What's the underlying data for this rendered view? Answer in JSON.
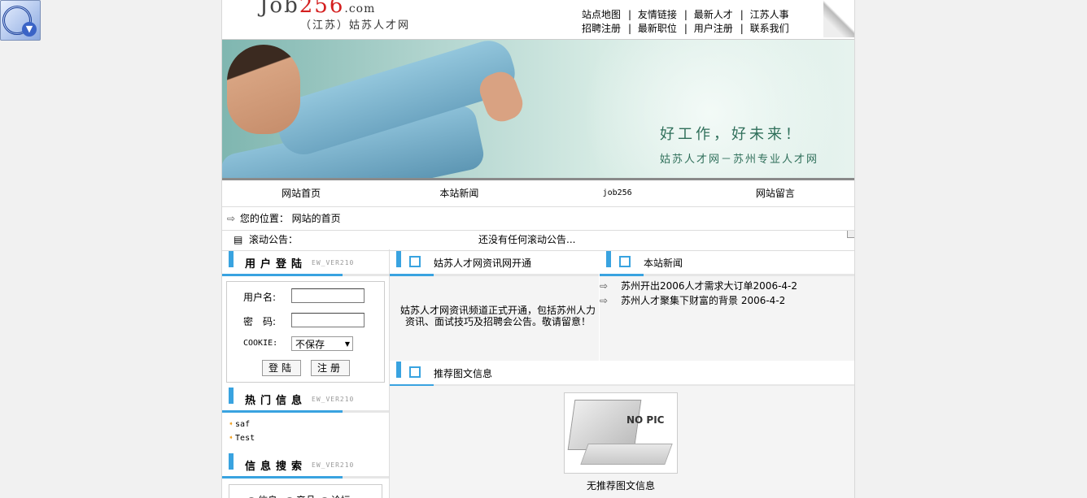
{
  "site": {
    "logo_text": "Job",
    "logo_num": "256",
    "logo_dot": ".com",
    "logo_sub": "（江苏）姑苏人才网"
  },
  "toplinks": {
    "row1": [
      "站点地图",
      "友情链接",
      "最新人才",
      "江苏人事"
    ],
    "row2": [
      "招聘注册",
      "最新职位",
      "用户注册",
      "联系我们"
    ]
  },
  "banner": {
    "slogan1": "好工作，好未来！",
    "slogan2": "姑苏人才网－苏州专业人才网"
  },
  "nav": [
    "网站首页",
    "本站新闻",
    "job256",
    "网站留言"
  ],
  "breadcrumb": {
    "label": "您的位置：",
    "value": "网站的首页"
  },
  "notice": {
    "label": "滚动公告：",
    "text": "还没有任何滚动公告..."
  },
  "login": {
    "title": "用户登陆",
    "ver": "EW_VER210",
    "username_label": "用户名:",
    "password_label": "密　码:",
    "cookie_label": "COOKIE:",
    "cookie_value": "不保存",
    "login_button": "登陆",
    "register_button": "注册"
  },
  "hot": {
    "title": "热门信息",
    "ver": "EW_VER210",
    "items": [
      "saf",
      "Test"
    ]
  },
  "search": {
    "title": "信息搜索",
    "ver": "EW_VER210",
    "options": [
      "信息",
      "产品",
      "论坛"
    ],
    "selected": "信息"
  },
  "channel": {
    "title": "姑苏人才网资讯网开通",
    "text": "姑苏人才网资讯频道正式开通，包括苏州人力资讯、面试技巧及招聘会公告。敬请留意！"
  },
  "news": {
    "title": "本站新闻",
    "items": [
      "苏州开出2006人才需求大订单2006-4-2",
      "苏州人才聚集下财富的背景 2006-4-2"
    ]
  },
  "recommend": {
    "title": "推荐图文信息",
    "nopic_label": "NO PIC",
    "caption": "无推荐图文信息"
  }
}
